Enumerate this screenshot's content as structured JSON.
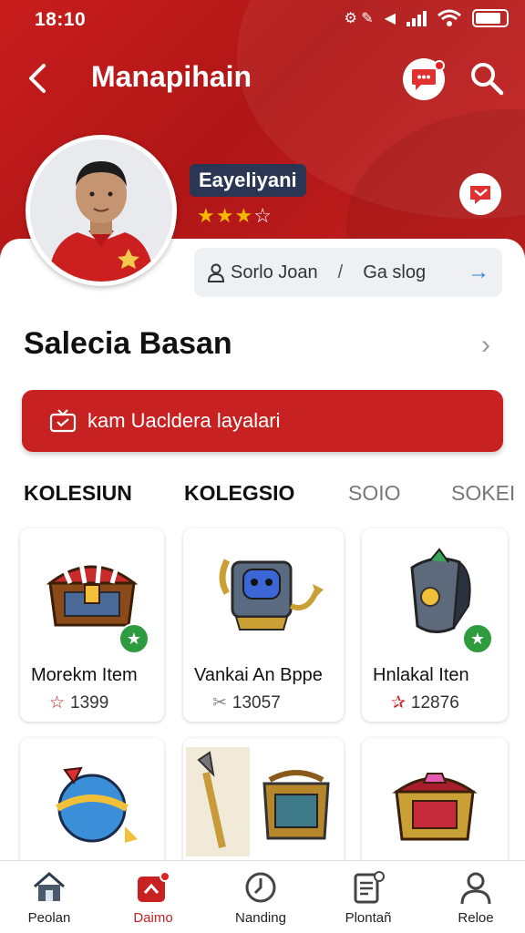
{
  "status_bar": {
    "time": "18:10"
  },
  "header": {
    "title": "Manapihain"
  },
  "profile": {
    "username": "Eayeliyani",
    "rating": 3,
    "rating_max": 4,
    "info_left": "Sorlo Joan",
    "info_sep": "/",
    "info_right": "Ga slog"
  },
  "section": {
    "title": "Salecia Basan"
  },
  "cta": {
    "label": "kam Uacldera layalari"
  },
  "tabs": [
    {
      "label": "KOLESIUN",
      "active": true
    },
    {
      "label": "KOLEGSIO",
      "active": true
    },
    {
      "label": "SOIO",
      "active": false
    },
    {
      "label": "SOKEI",
      "active": false
    }
  ],
  "items": [
    {
      "name": "Morekm Item",
      "count": "1399",
      "icon": "treasure-chest",
      "badge": true
    },
    {
      "name": "Vankai An Bppe",
      "count": "13057",
      "icon": "robot-gadget",
      "badge": false
    },
    {
      "name": "Hnlakal Iten",
      "count": "12876",
      "icon": "armor-shield",
      "badge": true
    },
    {
      "name": "",
      "count": "",
      "icon": "globe-relic",
      "badge": false
    },
    {
      "name": "",
      "count": "",
      "icon": "staff-and-chest",
      "badge": false
    },
    {
      "name": "",
      "count": "",
      "icon": "ruby-chest",
      "badge": false
    }
  ],
  "bottom_nav": [
    {
      "label": "Peolan",
      "icon": "home-icon",
      "active": false
    },
    {
      "label": "Daimo",
      "icon": "game-icon",
      "active": true
    },
    {
      "label": "Nanding",
      "icon": "timer-icon",
      "active": false
    },
    {
      "label": "Plontañ",
      "icon": "document-icon",
      "active": false
    },
    {
      "label": "Reloe",
      "icon": "user-icon",
      "active": false
    }
  ],
  "colors": {
    "brand_red": "#c72121",
    "header_red": "#b81818",
    "badge_green": "#2e9b3e",
    "star_gold": "#f5b800"
  }
}
